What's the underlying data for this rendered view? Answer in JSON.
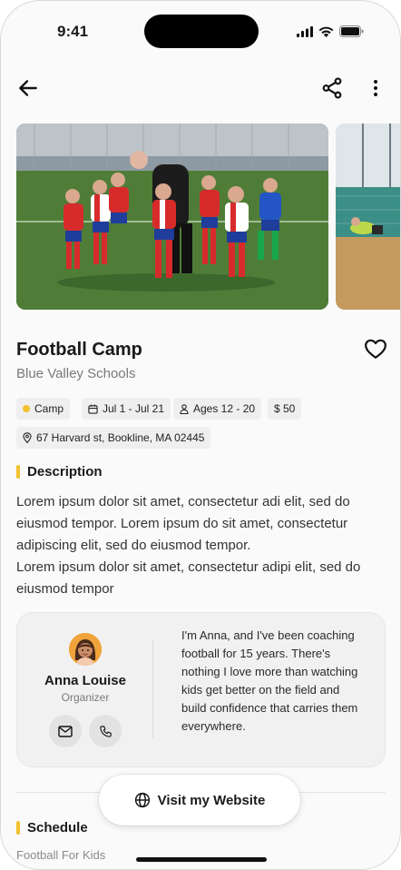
{
  "status_bar": {
    "time": "9:41"
  },
  "event": {
    "title": "Football Camp",
    "host": "Blue Valley Schools",
    "tags": {
      "type": "Camp",
      "dates": "Jul 1 - Jul 21",
      "ages": "Ages 12 - 20",
      "price": "$ 50"
    },
    "address": "67 Harvard st, Bookline, MA 02445",
    "accent_color": "#f2c12e"
  },
  "description": {
    "heading": "Description",
    "paragraph_1": "Lorem ipsum dolor sit amet, consectetur adi elit, sed do eiusmod tempor. Lorem ipsum do sit amet, consectetur adipiscing elit, sed do eiusmod tempor.",
    "paragraph_2": "Lorem ipsum dolor sit amet, consectetur adipi elit, sed do eiusmod tempor"
  },
  "organizer": {
    "name": "Anna Louise",
    "role": "Organizer",
    "bio": "I'm Anna, and I've been coaching football for 15 years. There's nothing I love more than watching kids get better on the field and build confidence that carries them everywhere."
  },
  "website_button": {
    "label": "Visit my Website"
  },
  "schedule": {
    "heading": "Schedule",
    "first_item": "Football For Kids"
  }
}
